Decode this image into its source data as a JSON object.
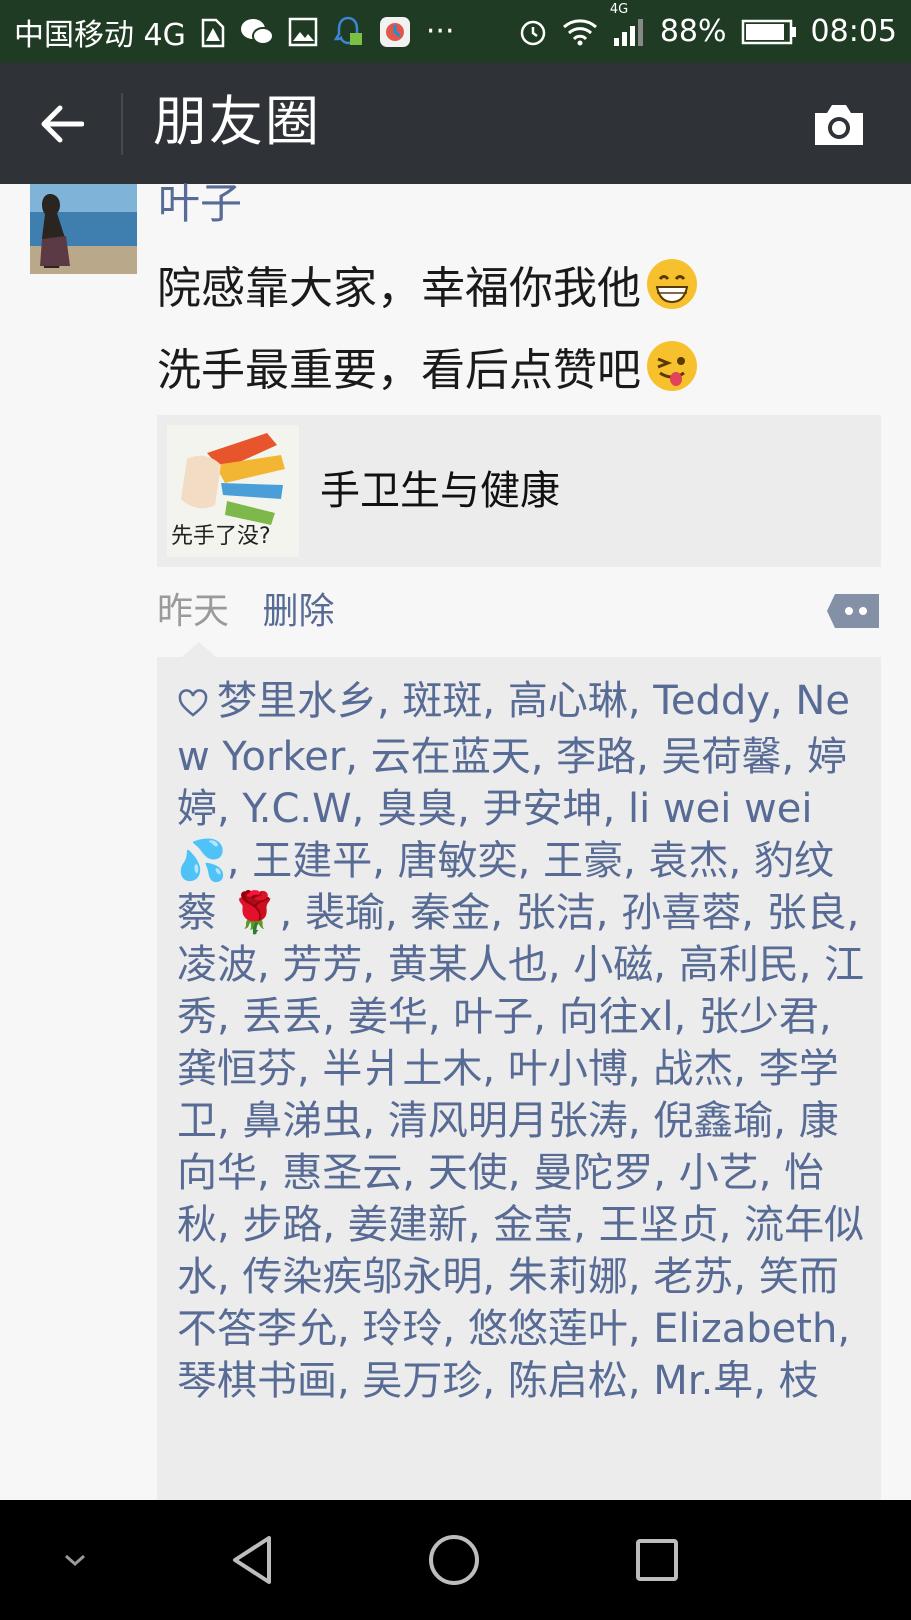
{
  "status_bar": {
    "carrier": "中国移动 4G",
    "network_badge": "4G",
    "battery": "88%",
    "time": "08:05",
    "icons": [
      "sim-warning-icon",
      "wechat-icon",
      "image-icon",
      "qq-icon",
      "app-icon",
      "more-dots-icon",
      "alarm-icon",
      "wifi-icon",
      "signal-icon",
      "battery-icon"
    ]
  },
  "header": {
    "title": "朋友圈",
    "back_icon": "arrow-left-icon",
    "camera_icon": "camera-icon",
    "background": "#2f3236"
  },
  "post": {
    "author": "叶子",
    "text_lines": [
      "院感靠大家，幸福你我他",
      "洗手最重要，看后点赞吧"
    ],
    "emojis": [
      "grinning-face-icon",
      "winking-tongue-face-icon"
    ],
    "link": {
      "title": "手卫生与健康",
      "thumb_text": "先手了没?"
    },
    "time": "昨天",
    "delete_label": "删除",
    "likes": {
      "heart_icon": "heart-outline-icon",
      "names_text": "梦里水乡, 斑斑, 高心琳, Teddy, New Yorker, 云在蓝天, 李路, 吴荷馨, 婷婷, Y.C.W, 臭臭, 尹安坤, li wei wei💦, 王建平, 唐敏奕, 王豪, 袁杰, 豹纹蔡 🌹, 裴瑜, 秦金, 张洁, 孙喜蓉, 张良, 凌波, 芳芳, 黄某人也, 小磁, 高利民, 江秀, 丢丢, 姜华, 叶子, 向往xl, 张少君, 龚恒芬, 半爿土木, 叶小博, 战杰, 李学卫, 鼻涕虫, 清风明月张涛, 倪鑫瑜, 康向华, 惠圣云, 天使, 曼陀罗, 小艺, 怡秋, 步路, 姜建新, 金莹, 王坚贞, 流年似水, 传染疾邬永明, 朱莉娜, 老苏, 笑而不答李允, 玲玲, 悠悠莲叶, Elizabeth, 琴棋书画, 吴万珍, 陈启松, Mr.卑, 枝"
    }
  },
  "colors": {
    "link_blue": "#576b95",
    "status_bar": "#1f3b24",
    "page_bg": "#f7f7f7",
    "card_bg": "#ececec"
  },
  "nav": {
    "icons": [
      "chevron-down-icon",
      "back-triangle-icon",
      "home-circle-icon",
      "recents-square-icon"
    ]
  }
}
